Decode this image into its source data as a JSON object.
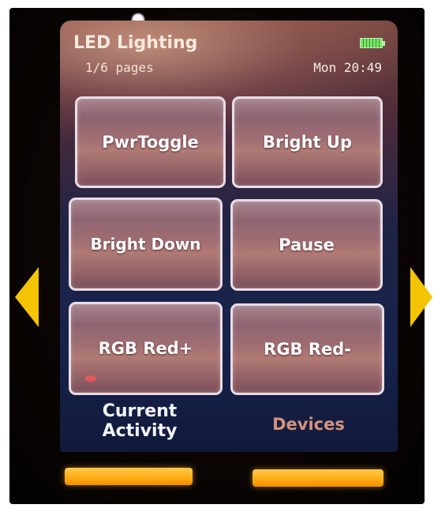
{
  "header": {
    "title": "LED Lighting",
    "page_indicator": "1/6 pages",
    "clock": "Mon 20:49"
  },
  "buttons": [
    {
      "label": "PwrToggle"
    },
    {
      "label": "Bright Up"
    },
    {
      "label": "Bright Down"
    },
    {
      "label": "Pause"
    },
    {
      "label": "RGB Red+"
    },
    {
      "label": "RGB Red-"
    }
  ],
  "softkeys": {
    "left": "Current Activity",
    "right": "Devices"
  },
  "icons": {
    "battery": "battery-full-icon",
    "nav_left": "arrow-left-icon",
    "nav_right": "arrow-right-icon"
  },
  "colors": {
    "accent_arrows": "#f5c400",
    "hardware_buttons": "#ffae18",
    "softkey_right_text": "#d4937c"
  }
}
